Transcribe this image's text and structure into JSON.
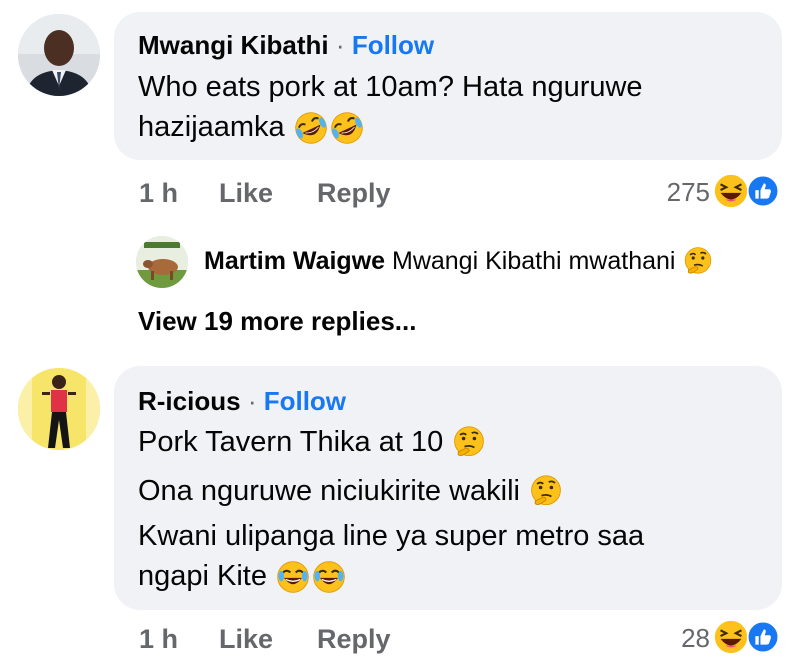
{
  "comments": [
    {
      "author": "Mwangi Kibathi",
      "dot": "·",
      "follow": "Follow",
      "line1": "Who eats pork at 10am? Hata nguruwe",
      "line2": "hazijaamka",
      "time": "1 h",
      "like": "Like",
      "reply": "Reply",
      "reaction_count": "275",
      "reactions": [
        "laugh-icon",
        "like-icon"
      ]
    },
    {
      "author": "R-icious",
      "dot": "·",
      "follow": "Follow",
      "line1": "Pork Tavern Thika at 10",
      "line2": "Ona nguruwe niciukirite wakili",
      "line3": "Kwani ulipanga line ya super metro saa",
      "line4": "ngapi Kite",
      "time": "1 h",
      "like": "Like",
      "reply": "Reply",
      "reaction_count": "28",
      "reactions": [
        "laugh-icon",
        "like-icon"
      ]
    }
  ],
  "reply_preview": {
    "author": "Martim Waigwe",
    "text": "Mwangi Kibathi mwathani"
  },
  "view_more": "View 19 more replies...",
  "colors": {
    "bubble": "#f0f2f5",
    "link": "#1877f2",
    "secondary": "#65676b",
    "emoji_yellow": "#fcc21b"
  }
}
